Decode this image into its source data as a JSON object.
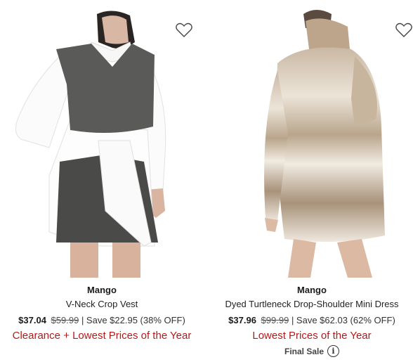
{
  "products": [
    {
      "brand": "Mango",
      "name": "V-Neck Crop Vest",
      "sale_price": "$37.04",
      "original_price": "$59.99",
      "savings": "| Save $22.95 (38% OFF)",
      "promo": "Clearance + Lowest Prices of the Year",
      "image_icon": "product-photo-crop-vest"
    },
    {
      "brand": "Mango",
      "name": "Dyed Turtleneck Drop-Shoulder Mini Dress",
      "sale_price": "$37.96",
      "original_price": "$99.99",
      "savings": "| Save $62.03 (62% OFF)",
      "promo": "Lowest Prices of the Year",
      "final_sale": "Final Sale",
      "image_icon": "product-photo-turtleneck-dress"
    }
  ],
  "icons": {
    "wishlist": "heart-outline-icon",
    "info": "info-icon"
  },
  "colors": {
    "promo": "#b31b1b",
    "text": "#1a1a1a"
  }
}
